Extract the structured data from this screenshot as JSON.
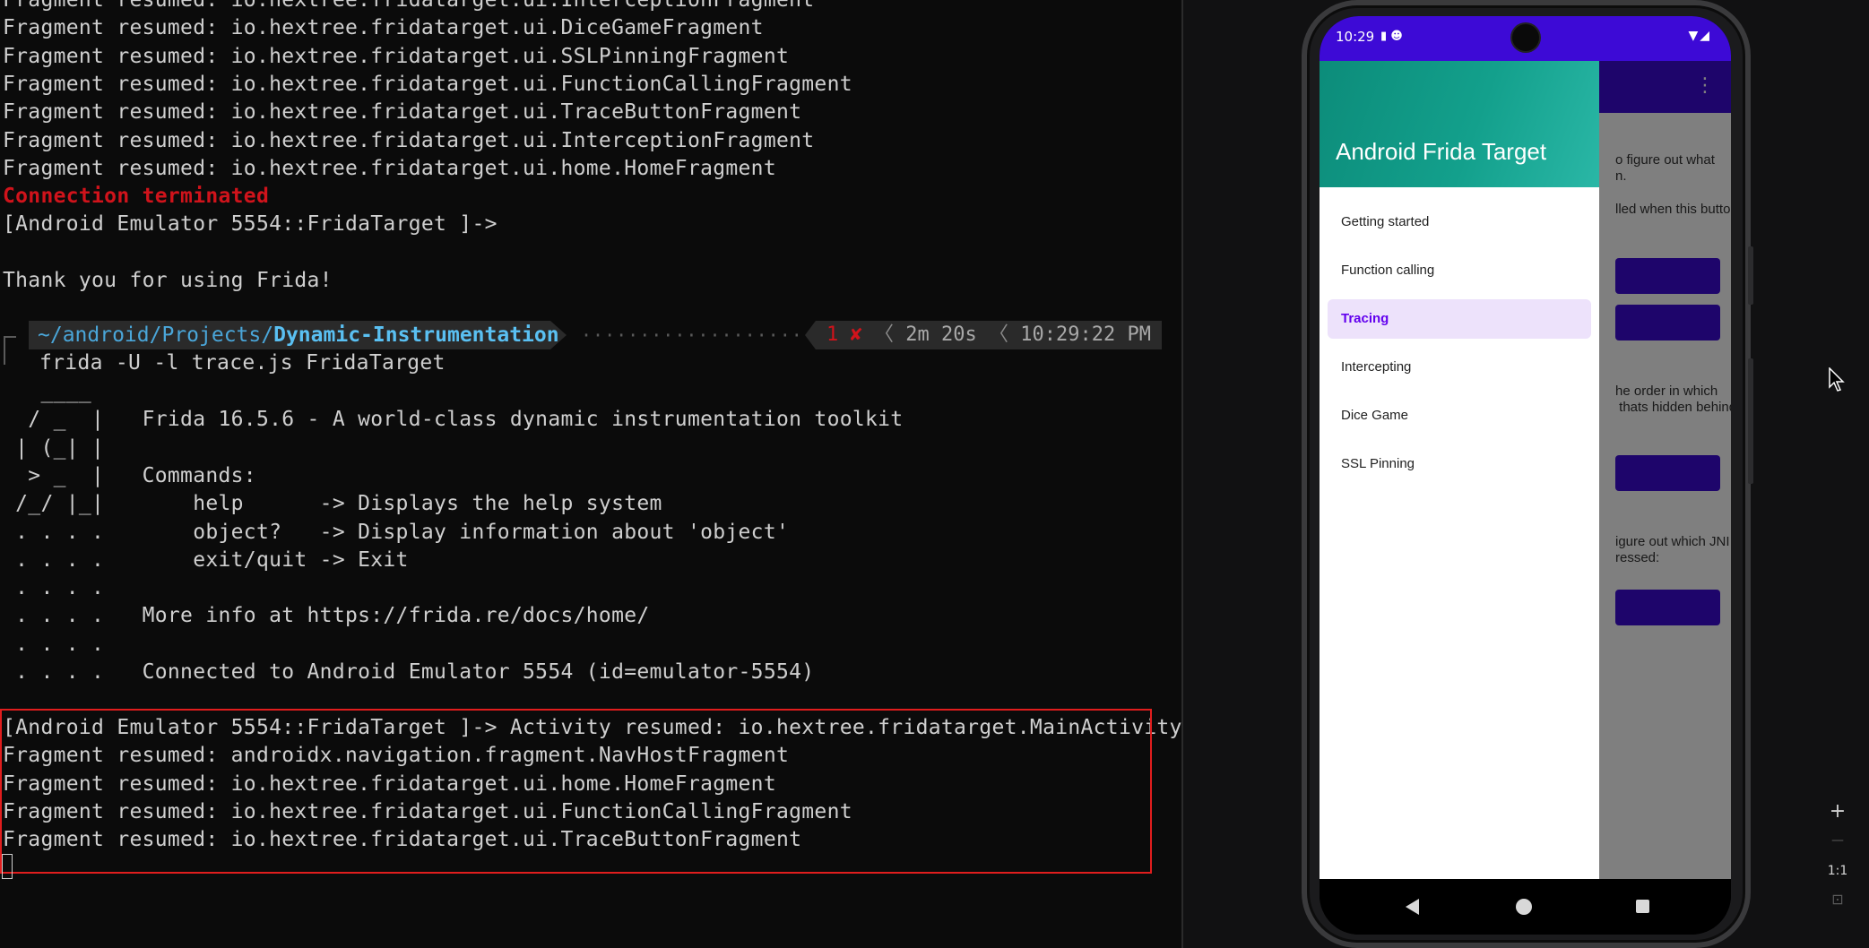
{
  "terminal": {
    "lines_top": [
      {
        "text": "Fragment resumed: io.hextree.fridatarget.ui.InterceptionFragment",
        "style": "normal"
      },
      {
        "text": "Fragment resumed: io.hextree.fridatarget.ui.DiceGameFragment",
        "style": "normal"
      },
      {
        "text": "Fragment resumed: io.hextree.fridatarget.ui.SSLPinningFragment",
        "style": "normal"
      },
      {
        "text": "Fragment resumed: io.hextree.fridatarget.ui.FunctionCallingFragment",
        "style": "normal"
      },
      {
        "text": "Fragment resumed: io.hextree.fridatarget.ui.TraceButtonFragment",
        "style": "normal"
      },
      {
        "text": "Fragment resumed: io.hextree.fridatarget.ui.InterceptionFragment",
        "style": "normal"
      },
      {
        "text": "Fragment resumed: io.hextree.fridatarget.ui.home.HomeFragment",
        "style": "normal"
      },
      {
        "text": "Connection terminated",
        "style": "red"
      },
      {
        "text": "[Android Emulator 5554::FridaTarget ]->",
        "style": "normal"
      },
      {
        "text": "",
        "style": "normal"
      },
      {
        "text": "Thank you for using Frida!",
        "style": "normal"
      }
    ],
    "prompt": {
      "path_prefix": "~/android/Projects/",
      "path_bold": "Dynamic-Instrumentation",
      "dots": "··························",
      "error_count": "1 ✘",
      "sep": "〈",
      "duration": "2m 20s",
      "time": "10:29:22 PM"
    },
    "command": "frida -U -l trace.js FridaTarget",
    "banner": [
      "   ____",
      "  / _  |   Frida 16.5.6 - A world-class dynamic instrumentation toolkit",
      " | (_| |",
      "  > _  |   Commands:",
      " /_/ |_|       help      -> Displays the help system",
      " . . . .       object?   -> Display information about 'object'",
      " . . . .       exit/quit -> Exit",
      " . . . .",
      " . . . .   More info at https://frida.re/docs/home/",
      " . . . .",
      " . . . .   Connected to Android Emulator 5554 (id=emulator-5554)"
    ],
    "highlighted": [
      "[Android Emulator 5554::FridaTarget ]-> Activity resumed: io.hextree.fridatarget.MainActivity",
      "Fragment resumed: androidx.navigation.fragment.NavHostFragment",
      "Fragment resumed: io.hextree.fridatarget.ui.home.HomeFragment",
      "Fragment resumed: io.hextree.fridatarget.ui.FunctionCallingFragment",
      "Fragment resumed: io.hextree.fridatarget.ui.TraceButtonFragment"
    ]
  },
  "phone": {
    "status_time": "10:29",
    "status_left_icons": "▮ ☻",
    "status_right_icons": "▼◢",
    "app_title": "Android Frida Target",
    "nav_items": [
      {
        "label": "Getting started",
        "active": false
      },
      {
        "label": "Function calling",
        "active": false
      },
      {
        "label": "Tracing",
        "active": true
      },
      {
        "label": "Intercepting",
        "active": false
      },
      {
        "label": "Dice Game",
        "active": false
      },
      {
        "label": "SSL Pinning",
        "active": false
      }
    ],
    "background_texts": [
      "o figure out what\nn.",
      "lled when this button",
      "he order in which\n thats hidden behind",
      "igure out which JNI\nressed:"
    ],
    "overflow_icon": "⋮"
  },
  "emulator_controls": {
    "zoom_in": "+",
    "zoom_out": "—",
    "actual_size": "1:1",
    "fit": "⊡"
  },
  "colors": {
    "accent": "#3d0ad6",
    "drawer_header": "#13a08c",
    "active_item_bg": "#ede2fb",
    "active_item_text": "#6200ee",
    "terminal_red": "#d0131b",
    "path_blue": "#5ac0f2"
  }
}
